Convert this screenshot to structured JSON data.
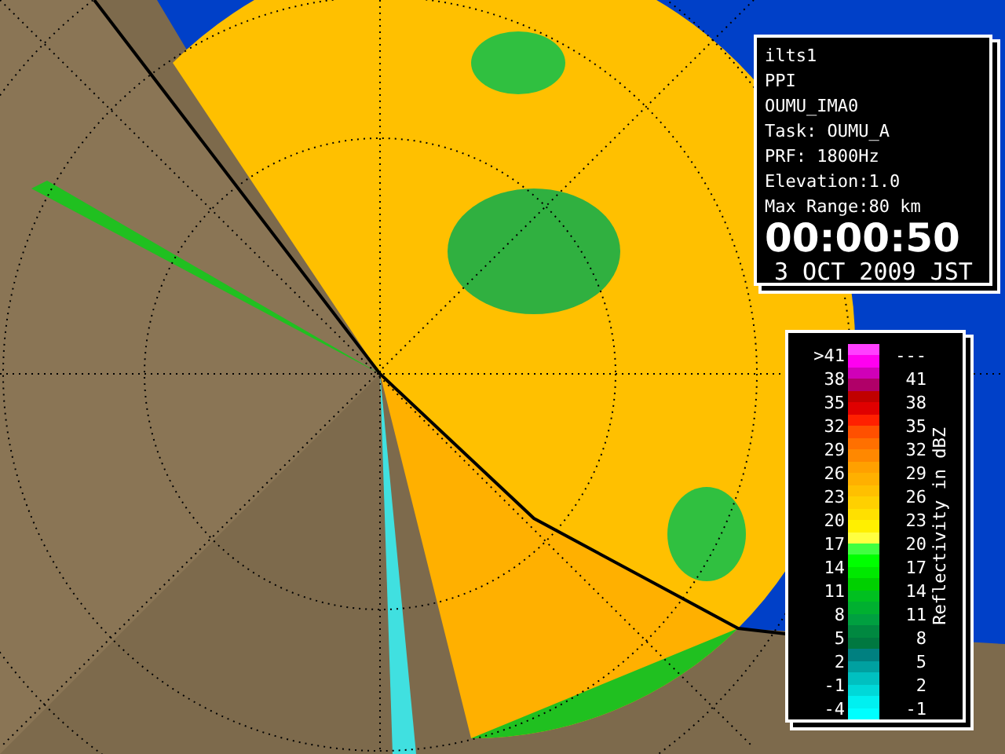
{
  "info_panel": {
    "lines": [
      "ilts1",
      "PPI",
      "OUMU_IMA0",
      "Task: OUMU_A",
      "PRF: 1800Hz",
      "Elevation:1.0",
      "Max Range:80 km"
    ],
    "time": "00:00:50",
    "date": "3 OCT 2009 JST"
  },
  "legend": {
    "title": "Reflectivity in dBZ",
    "rows": [
      {
        "low": ">41",
        "high": "---"
      },
      {
        "low": "38",
        "high": "41"
      },
      {
        "low": "35",
        "high": "38"
      },
      {
        "low": "32",
        "high": "35"
      },
      {
        "low": "29",
        "high": "32"
      },
      {
        "low": "26",
        "high": "29"
      },
      {
        "low": "23",
        "high": "26"
      },
      {
        "low": "20",
        "high": "23"
      },
      {
        "low": "17",
        "high": "20"
      },
      {
        "low": "14",
        "high": "17"
      },
      {
        "low": "11",
        "high": "14"
      },
      {
        "low": "8",
        "high": "11"
      },
      {
        "low": "5",
        "high": "8"
      },
      {
        "low": "2",
        "high": "5"
      },
      {
        "low": "-1",
        "high": "2"
      },
      {
        "low": "-4",
        "high": "-1"
      }
    ],
    "swatches": [
      {
        "color": "#ff40ff"
      },
      {
        "color": "#ff00f0"
      },
      {
        "color": "#d000b8"
      },
      {
        "color": "#b00068"
      },
      {
        "color": "#c00000"
      },
      {
        "color": "#e00000"
      },
      {
        "color": "#ff2000"
      },
      {
        "color": "#ff5000"
      },
      {
        "color": "#ff7000"
      },
      {
        "color": "#ff8800"
      },
      {
        "color": "#ffa000"
      },
      {
        "color": "#ffb000"
      },
      {
        "color": "#ffc000"
      },
      {
        "color": "#ffd000"
      },
      {
        "color": "#ffe000"
      },
      {
        "color": "#fff000"
      },
      {
        "color": "#ffff40"
      },
      {
        "color": "#40ff40"
      },
      {
        "color": "#00ff00"
      },
      {
        "color": "#00e800"
      },
      {
        "color": "#00d000"
      },
      {
        "color": "#00c020"
      },
      {
        "color": "#00b030"
      },
      {
        "color": "#00a040"
      },
      {
        "color": "#008840"
      },
      {
        "color": "#007840"
      },
      {
        "color": "#008080"
      },
      {
        "color": "#00a0a0"
      },
      {
        "color": "#00c0c0"
      },
      {
        "color": "#00d8d8"
      },
      {
        "color": "#00f0f0"
      },
      {
        "color": "#00ffff"
      }
    ]
  }
}
